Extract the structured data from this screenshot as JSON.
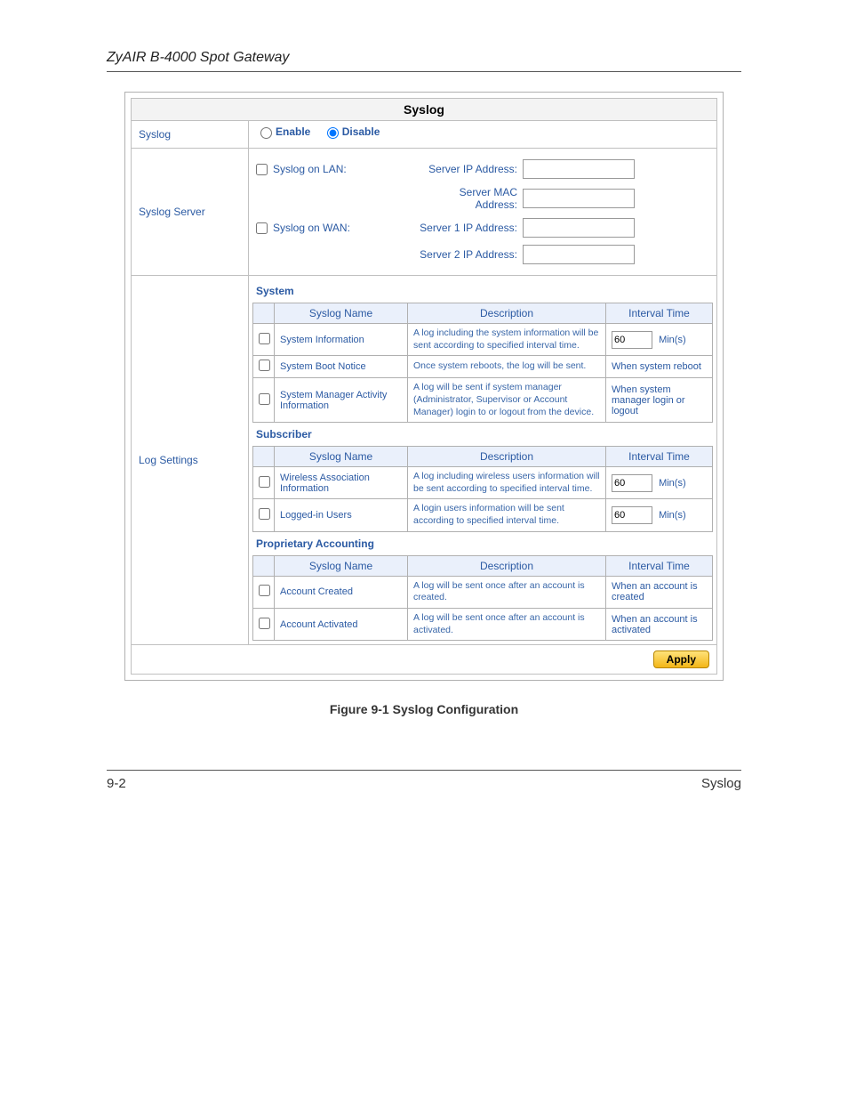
{
  "doc_header": "ZyAIR B-4000 Spot Gateway",
  "panel_title": "Syslog",
  "rows": {
    "syslog_label": "Syslog",
    "enable_label": "Enable",
    "disable_label": "Disable",
    "syslog_server_label": "Syslog Server",
    "log_settings_label": "Log Settings"
  },
  "server": {
    "lan_label": "Syslog on LAN:",
    "wan_label": "Syslog on WAN:",
    "server_ip": "Server IP Address:",
    "server_mac": "Server MAC Address:",
    "server1_ip": "Server 1 IP Address:",
    "server2_ip": "Server 2 IP Address:"
  },
  "headers": {
    "name": "Syslog Name",
    "desc": "Description",
    "interval": "Interval Time"
  },
  "units_min": "Min(s)",
  "sections": {
    "system": {
      "title": "System",
      "items": [
        {
          "name": "System Information",
          "desc": "A log including the system information will be sent according to specified interval time.",
          "interval_type": "input",
          "interval_value": "60"
        },
        {
          "name": "System Boot Notice",
          "desc": "Once system reboots, the log will be sent.",
          "interval_type": "text",
          "interval_text": "When system reboot"
        },
        {
          "name": "System Manager Activity Information",
          "desc": "A log will be sent if system manager (Administrator, Supervisor or Account Manager) login to or logout from the device.",
          "interval_type": "text",
          "interval_text": "When system manager login or logout"
        }
      ]
    },
    "subscriber": {
      "title": "Subscriber",
      "items": [
        {
          "name": "Wireless Association Information",
          "desc": "A log including wireless users information will be sent according to specified interval time.",
          "interval_type": "input",
          "interval_value": "60"
        },
        {
          "name": "Logged-in Users",
          "desc": "A login users information will be sent according to specified interval time.",
          "interval_type": "input",
          "interval_value": "60"
        }
      ]
    },
    "accounting": {
      "title": "Proprietary Accounting",
      "items": [
        {
          "name": "Account Created",
          "desc": "A log will be sent once after an account is created.",
          "interval_type": "text",
          "interval_text": "When an account is created"
        },
        {
          "name": "Account Activated",
          "desc": "A log will be sent once after an account is activated.",
          "interval_type": "text",
          "interval_text": "When an account is activated"
        }
      ]
    }
  },
  "apply_label": "Apply",
  "figure_caption": "Figure 9-1 Syslog Configuration",
  "footer": {
    "left": "9-2",
    "right": "Syslog"
  }
}
